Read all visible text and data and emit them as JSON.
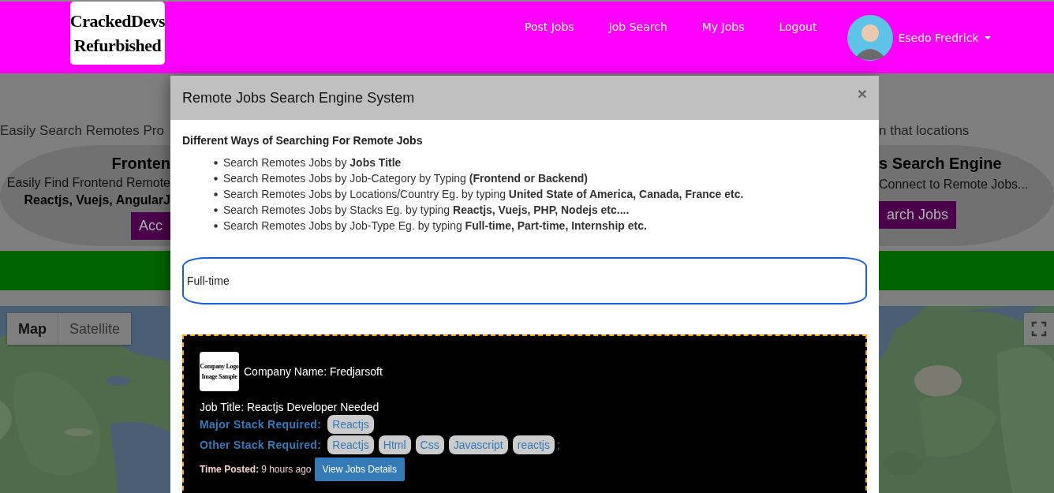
{
  "navbar": {
    "logo_lines": [
      "CrackedDevs",
      "Refurbished"
    ],
    "links": [
      "Post Jobs",
      "Job Search",
      "My Jobs",
      "Logout"
    ],
    "user": {
      "name": "Esedo Fredrick"
    }
  },
  "background": {
    "left": {
      "intro": "Easily Search Remotes Pro",
      "title": "Fronten",
      "text": "Easily Find Frontend Remote",
      "stacks": "Reactjs, Vuejs, AngularJ",
      "button": "Acc"
    },
    "right": {
      "intro": "n that locations",
      "title": "s Search Engine",
      "text": "Connect to Remote Jobs...",
      "button": "arch Jobs"
    }
  },
  "map": {
    "buttons": [
      {
        "label": "Map",
        "selected": true
      },
      {
        "label": "Satellite",
        "selected": false
      }
    ]
  },
  "modal": {
    "title": "Remote Jobs Search Engine System",
    "close": "×",
    "heading": "Different Ways of Searching For Remote Jobs",
    "ways": [
      "Search Remotes Jobs by **Jobs Title**",
      "Search Remotes Jobs by Job-Category by Typing **(Frontend or Backend)**",
      "Search Remotes Jobs by Locations/Country Eg. by typing **United State of America, Canada, France etc.**",
      "Search Remotes Jobs by Stacks Eg. by typing **Reactjs, Vuejs, PHP, Nodejs etc....**",
      "Search Remotes Jobs by Job-Type Eg. by typing **Full-time, Part-time, Internship etc.**"
    ],
    "search": {
      "value": "Full-time"
    },
    "results": [
      {
        "logo_lines": [
          "Company Logo",
          "Image Sample"
        ],
        "company": "Company Name: Fredjarsoft",
        "job_title": "Job Title: Reactjs Developer Needed",
        "major_label": "Major Stack Required:",
        "major": [
          "Reactjs"
        ],
        "other_label": "Other Stack Required:",
        "other": [
          "Reactjs",
          "Html",
          "Css",
          "Javascript",
          "reactjs"
        ],
        "separator": ";",
        "time_label": "Time Posted:",
        "time": "9 hours ago",
        "button": "View Jobs Details"
      }
    ]
  }
}
